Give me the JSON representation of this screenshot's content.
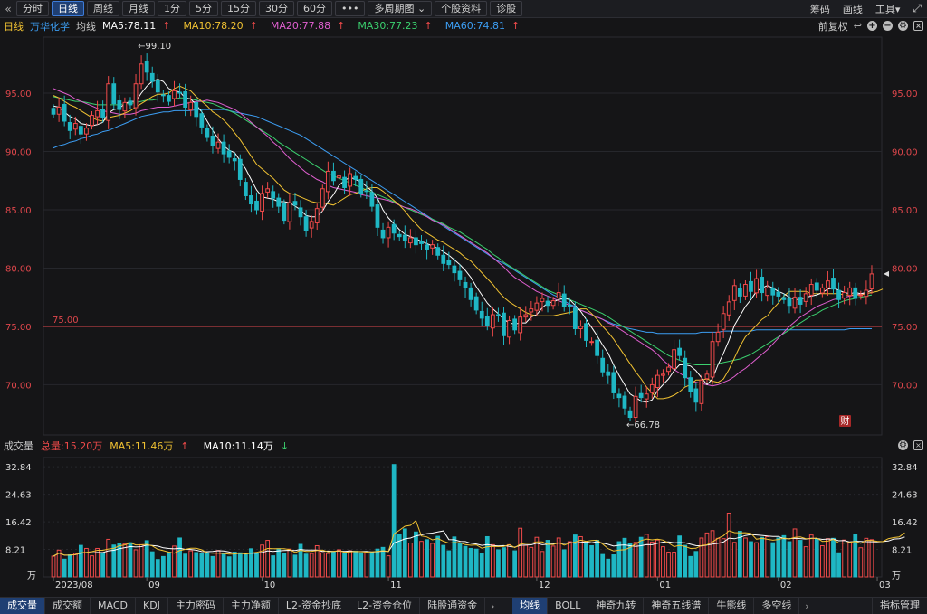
{
  "toolbar": {
    "back_icon": "double-left-chevron",
    "periods": [
      "分时",
      "日线",
      "周线",
      "月线",
      "1分",
      "5分",
      "15分",
      "30分",
      "60分",
      "•••"
    ],
    "active_period": "日线",
    "multi_period": "多周期图",
    "info": "个股资料",
    "diagnose": "诊股",
    "right": {
      "chips": "筹码",
      "draw": "画线",
      "tools": "工具"
    }
  },
  "ma_header": {
    "period": "日线",
    "stock_name": "万华化学",
    "ma_label": "均线",
    "ma5": "MA5:78.11",
    "ma10": "MA10:78.20",
    "ma20": "MA20:77.88",
    "ma30": "MA30:77.23",
    "ma60": "MA60:74.81",
    "adjust": "前复权"
  },
  "colors": {
    "up": "#f04a4a",
    "down": "#1fb7c4",
    "ma5": "#ffffff",
    "ma10": "#f1c232",
    "ma20": "#e05fd0",
    "ma30": "#3bd16f",
    "ma60": "#3c9df2",
    "price_axis": "#e0474c"
  },
  "price_chart": {
    "y_ticks": [
      "95.00",
      "90.00",
      "85.00",
      "80.00",
      "75.00",
      "70.00"
    ],
    "y_tick_values": [
      95,
      90,
      85,
      80,
      75,
      70
    ],
    "ref_line_label": "75.00",
    "ref_line_value": 75,
    "high_label": "←99.10",
    "low_label": "←66.78",
    "badge": "财"
  },
  "volume_header": {
    "title": "成交量",
    "total": "总量:15.20万",
    "ma5": "MA5:11.46万",
    "ma10": "MA10:11.14万"
  },
  "volume_chart": {
    "y_ticks": [
      "32.84",
      "24.63",
      "16.42",
      "8.21",
      "万"
    ],
    "x_labels": [
      "2023/08",
      "09",
      "10",
      "11",
      "12",
      "01",
      "02",
      "03"
    ]
  },
  "chart_data": {
    "type": "candlestick",
    "close": [
      93.2,
      93.8,
      92.6,
      91.8,
      92.4,
      91.5,
      92.0,
      93.1,
      93.5,
      92.9,
      95.8,
      94.1,
      93.6,
      94.2,
      94.0,
      95.8,
      97.5,
      96.8,
      96.0,
      95.1,
      94.8,
      94.3,
      95.2,
      95.0,
      93.8,
      94.2,
      93.0,
      92.1,
      91.2,
      90.5,
      90.8,
      89.8,
      89.5,
      89.2,
      87.6,
      86.2,
      85.5,
      85.0,
      86.4,
      86.8,
      86.0,
      85.3,
      84.1,
      85.6,
      85.4,
      84.4,
      83.2,
      84.0,
      85.1,
      86.8,
      88.3,
      87.5,
      87.9,
      86.9,
      88.1,
      87.6,
      86.4,
      86.6,
      85.3,
      83.5,
      82.6,
      83.5,
      83.0,
      82.7,
      82.4,
      82.6,
      82.0,
      82.1,
      81.6,
      82.0,
      81.1,
      80.4,
      80.3,
      79.6,
      79.0,
      78.3,
      77.3,
      76.4,
      75.7,
      75.1,
      76.0,
      75.9,
      74.2,
      75.5,
      74.7,
      75.8,
      76.0,
      76.5,
      77.0,
      77.4,
      76.8,
      77.2,
      77.9,
      76.7,
      76.8,
      74.8,
      75.0,
      73.8,
      73.7,
      72.5,
      71.1,
      70.8,
      69.3,
      68.9,
      68.0,
      67.2,
      69.0,
      68.9,
      69.2,
      70.0,
      70.8,
      70.9,
      71.5,
      73.0,
      72.5,
      70.6,
      69.4,
      68.5,
      70.4,
      70.9,
      73.7,
      74.5,
      76.1,
      77.1,
      78.5,
      77.6,
      78.6,
      78.0,
      79.1,
      77.9,
      78.3,
      77.7,
      77.6,
      77.3,
      76.8,
      77.5,
      76.9,
      77.8,
      78.6,
      78.1,
      78.3,
      78.9,
      78.2,
      77.3,
      77.9,
      78.3,
      77.4,
      77.7,
      78.1,
      79.5
    ],
    "ma5": [
      93.9,
      93.8,
      93.4,
      93.0,
      92.8,
      92.4,
      92.3,
      92.2,
      92.3,
      92.5,
      93.3,
      93.6,
      93.7,
      94.1,
      94.3,
      94.3,
      95.0,
      95.6,
      96.0,
      96.2,
      96.0,
      95.4,
      95.2,
      95.1,
      94.6,
      94.5,
      94.0,
      93.4,
      92.6,
      91.8,
      91.1,
      90.5,
      90.1,
      89.9,
      89.2,
      88.5,
      87.6,
      86.7,
      86.1,
      86.0,
      85.9,
      85.7,
      85.7,
      85.6,
      85.3,
      85.0,
      84.5,
      84.4,
      84.4,
      84.9,
      85.7,
      86.3,
      87.1,
      87.5,
      87.8,
      87.6,
      87.4,
      87.0,
      86.6,
      86.0,
      85.0,
      84.3,
      83.8,
      83.3,
      82.9,
      82.7,
      82.5,
      82.3,
      82.1,
      81.9,
      81.7,
      81.4,
      81.1,
      80.7,
      80.3,
      79.8,
      79.2,
      78.4,
      77.7,
      77.0,
      76.5,
      76.1,
      75.6,
      75.3,
      75.2,
      75.3,
      75.3,
      75.8,
      76.0,
      76.6,
      77.0,
      77.1,
      77.3,
      77.4,
      77.3,
      76.8,
      76.3,
      75.6,
      74.9,
      74.2,
      73.4,
      72.7,
      71.7,
      70.8,
      70.0,
      69.2,
      68.9,
      68.6,
      68.5,
      68.7,
      69.5,
      70.0,
      70.5,
      71.2,
      71.7,
      71.7,
      71.6,
      71.2,
      70.6,
      70.0,
      70.5,
      71.7,
      72.7,
      73.8,
      75.1,
      75.9,
      76.7,
      77.3,
      78.0,
      78.3,
      78.5,
      78.3,
      78.0,
      77.8,
      77.5,
      77.3,
      77.3,
      77.5,
      77.6,
      77.7,
      77.9,
      78.2,
      78.3,
      78.1,
      77.9,
      77.8,
      77.9,
      77.8,
      77.9,
      78.1
    ],
    "ma10": [
      94.8,
      94.6,
      94.3,
      94.0,
      93.8,
      93.5,
      93.2,
      92.9,
      92.7,
      92.6,
      92.9,
      93.0,
      93.1,
      93.3,
      93.5,
      93.8,
      94.1,
      94.4,
      94.7,
      94.9,
      94.9,
      95.0,
      95.4,
      95.6,
      95.4,
      95.2,
      94.7,
      94.3,
      93.9,
      93.4,
      93.1,
      92.7,
      92.2,
      91.6,
      91.0,
      90.3,
      89.6,
      88.9,
      88.5,
      88.1,
      87.7,
      87.2,
      86.7,
      86.4,
      86.3,
      86.1,
      85.9,
      85.7,
      85.6,
      85.6,
      85.5,
      85.4,
      85.7,
      86.0,
      86.3,
      86.4,
      86.6,
      86.8,
      86.9,
      86.9,
      86.6,
      86.2,
      85.8,
      85.4,
      84.9,
      84.3,
      83.8,
      83.3,
      83.0,
      82.7,
      82.4,
      82.2,
      81.9,
      81.6,
      81.3,
      80.9,
      80.6,
      80.1,
      79.6,
      79.1,
      78.6,
      78.0,
      77.5,
      77.1,
      76.8,
      76.5,
      76.2,
      76.0,
      75.9,
      75.9,
      75.9,
      75.9,
      76.0,
      76.1,
      76.2,
      76.3,
      76.5,
      76.5,
      76.1,
      75.6,
      75.0,
      74.5,
      73.9,
      73.2,
      72.5,
      71.8,
      71.1,
      70.5,
      69.8,
      69.3,
      68.8,
      68.8,
      68.9,
      69.1,
      69.4,
      69.8,
      70.0,
      70.4,
      70.4,
      70.5,
      70.3,
      70.2,
      70.5,
      71.3,
      72.3,
      73.3,
      74.1,
      74.6,
      75.1,
      75.6,
      75.9,
      76.5,
      77.0,
      77.6,
      78.0,
      78.0,
      78.0,
      78.0,
      77.8,
      77.8,
      77.8,
      77.8,
      77.8,
      77.8,
      77.7,
      77.7,
      77.7,
      77.7,
      77.8,
      77.9,
      78.0,
      78.2
    ],
    "ma20": [
      95.4,
      95.2,
      95.0,
      94.8,
      94.5,
      94.3,
      94.1,
      93.9,
      93.7,
      93.5,
      93.4,
      93.3,
      93.2,
      93.2,
      93.2,
      93.3,
      93.5,
      93.6,
      93.7,
      93.8,
      93.8,
      93.8,
      93.9,
      94.0,
      94.1,
      94.2,
      94.3,
      94.3,
      94.4,
      94.3,
      94.2,
      94.0,
      93.8,
      93.6,
      93.3,
      92.9,
      92.5,
      92.1,
      91.7,
      91.3,
      90.8,
      90.4,
      89.9,
      89.4,
      89.0,
      88.6,
      88.2,
      87.9,
      87.6,
      87.4,
      87.1,
      86.9,
      86.8,
      86.7,
      86.6,
      86.5,
      86.3,
      86.2,
      86.1,
      86.0,
      85.9,
      85.8,
      85.6,
      85.4,
      85.2,
      85.1,
      84.9,
      84.7,
      84.4,
      84.1,
      83.9,
      83.7,
      83.4,
      83.1,
      82.8,
      82.5,
      82.2,
      81.9,
      81.6,
      81.3,
      80.9,
      80.5,
      80.1,
      79.6,
      79.2,
      78.9,
      78.6,
      78.3,
      78.0,
      77.8,
      77.6,
      77.4,
      77.2,
      77.0,
      76.8,
      76.6,
      76.4,
      76.2,
      76.0,
      75.8,
      75.6,
      75.3,
      75.1,
      74.8,
      74.5,
      74.2,
      73.9,
      73.6,
      73.3,
      73.0,
      72.6,
      72.1,
      71.7,
      71.3,
      71.0,
      70.7,
      70.4,
      70.2,
      70.1,
      70.0,
      69.9,
      70.0,
      70.2,
      70.4,
      70.7,
      71.1,
      71.4,
      71.8,
      72.2,
      72.6,
      73.0,
      73.5,
      74.0,
      74.5,
      75.0,
      75.4,
      75.8,
      76.1,
      76.4,
      76.7,
      76.9,
      77.1,
      77.3,
      77.4,
      77.5,
      77.6,
      77.7,
      77.8,
      77.8,
      77.9
    ],
    "ma30": [
      94.7,
      94.6,
      94.5,
      94.4,
      94.3,
      94.3,
      94.2,
      94.1,
      94.0,
      94.0,
      94.0,
      94.0,
      94.0,
      94.1,
      94.1,
      94.2,
      94.3,
      94.4,
      94.4,
      94.5,
      94.5,
      94.5,
      94.5,
      94.6,
      94.6,
      94.5,
      94.4,
      94.3,
      94.2,
      94.1,
      93.9,
      93.7,
      93.5,
      93.3,
      93.0,
      92.7,
      92.4,
      92.1,
      91.8,
      91.5,
      91.2,
      90.8,
      90.5,
      90.2,
      89.9,
      89.6,
      89.3,
      89.0,
      88.7,
      88.4,
      88.1,
      87.9,
      87.7,
      87.5,
      87.3,
      87.1,
      86.9,
      86.7,
      86.5,
      86.3,
      86.1,
      85.9,
      85.7,
      85.4,
      85.2,
      85.0,
      84.8,
      84.6,
      84.4,
      84.2,
      84.0,
      83.8,
      83.5,
      83.3,
      83.1,
      82.8,
      82.5,
      82.2,
      81.9,
      81.6,
      81.2,
      80.9,
      80.5,
      80.2,
      79.9,
      79.6,
      79.3,
      79.0,
      78.7,
      78.4,
      78.1,
      77.9,
      77.7,
      77.5,
      77.3,
      77.1,
      76.9,
      76.7,
      76.5,
      76.3,
      76.1,
      75.8,
      75.5,
      75.2,
      74.9,
      74.6,
      74.3,
      74.0,
      73.7,
      73.4,
      73.1,
      72.8,
      72.5,
      72.3,
      72.1,
      71.9,
      71.8,
      71.7,
      71.7,
      71.7,
      71.7,
      71.8,
      71.9,
      72.0,
      72.1,
      72.2,
      72.4,
      72.6,
      72.9,
      73.2,
      73.5,
      73.8,
      74.1,
      74.4,
      74.7,
      75.0,
      75.3,
      75.6,
      75.9,
      76.1,
      76.4,
      76.6,
      76.8,
      77.0,
      77.2,
      77.3,
      77.4,
      77.5,
      77.6,
      77.7
    ],
    "ma60": [
      90.3,
      90.5,
      90.6,
      90.8,
      90.9,
      91.1,
      91.2,
      91.4,
      91.5,
      91.7,
      91.8,
      92.0,
      92.2,
      92.4,
      92.6,
      92.8,
      93.0,
      93.1,
      93.2,
      93.3,
      93.4,
      93.4,
      93.5,
      93.5,
      93.5,
      93.5,
      93.6,
      93.6,
      93.6,
      93.6,
      93.6,
      93.6,
      93.5,
      93.4,
      93.3,
      93.2,
      93.1,
      93.0,
      92.8,
      92.6,
      92.4,
      92.2,
      92.0,
      91.8,
      91.6,
      91.4,
      91.1,
      90.8,
      90.5,
      90.2,
      89.9,
      89.6,
      89.3,
      89.0,
      88.7,
      88.4,
      88.1,
      87.8,
      87.5,
      87.2,
      86.9,
      86.6,
      86.3,
      86.0,
      85.7,
      85.4,
      85.1,
      84.8,
      84.5,
      84.2,
      83.9,
      83.6,
      83.3,
      83.0,
      82.7,
      82.4,
      82.1,
      81.8,
      81.5,
      81.2,
      80.9,
      80.6,
      80.4,
      80.1,
      79.8,
      79.5,
      79.2,
      78.9,
      78.6,
      78.3,
      78.0,
      77.7,
      77.5,
      77.2,
      76.9,
      76.7,
      76.4,
      76.2,
      76.0,
      75.8,
      75.6,
      75.4,
      75.2,
      75.1,
      74.9,
      74.8,
      74.7,
      74.6,
      74.5,
      74.5,
      74.4,
      74.4,
      74.4,
      74.4,
      74.4,
      74.4,
      74.4,
      74.4,
      74.5,
      74.5,
      74.5,
      74.5,
      74.6,
      74.6,
      74.6,
      74.6,
      74.6,
      74.6,
      74.7,
      74.7,
      74.7,
      74.7,
      74.7,
      74.7,
      74.7,
      74.7,
      74.7,
      74.7,
      74.7,
      74.7,
      74.7,
      74.7,
      74.7,
      74.7,
      74.7,
      74.8,
      74.8,
      74.8,
      74.8,
      74.8
    ],
    "volume": [
      6.2,
      8.0,
      5.3,
      6.6,
      7.0,
      9.4,
      8.5,
      6.3,
      8.5,
      7.1,
      11.2,
      9.5,
      10.1,
      9.8,
      10.2,
      8.1,
      9.6,
      10.8,
      7.5,
      5.2,
      6.1,
      7.4,
      9.2,
      11.6,
      6.8,
      7.8,
      7.3,
      6.9,
      7.2,
      6.1,
      7.9,
      6.8,
      6.0,
      7.4,
      7.2,
      6.6,
      8.4,
      7.1,
      9.5,
      10.9,
      6.3,
      8.4,
      6.9,
      8.3,
      6.5,
      9.7,
      6.8,
      7.0,
      9.3,
      7.2,
      7.0,
      7.6,
      8.1,
      6.9,
      7.8,
      7.7,
      7.2,
      7.5,
      7.3,
      8.3,
      8.8,
      6.3,
      33.5,
      12.6,
      14.3,
      10.1,
      13.4,
      10.6,
      11.1,
      10.0,
      12.1,
      9.4,
      7.8,
      11.9,
      9.9,
      9.1,
      8.5,
      8.3,
      7.1,
      12.0,
      9.6,
      8.1,
      8.7,
      9.6,
      7.8,
      14.5,
      9.4,
      8.8,
      11.8,
      7.6,
      10.9,
      9.2,
      11.6,
      8.1,
      10.5,
      12.5,
      12.0,
      10.0,
      9.3,
      10.9,
      6.7,
      5.3,
      6.6,
      10.5,
      11.5,
      10.1,
      10.3,
      11.8,
      12.7,
      10.4,
      11.0,
      9.0,
      7.4,
      7.4,
      12.2,
      9.4,
      6.1,
      7.6,
      11.6,
      13.1,
      13.8,
      11.5,
      11.4,
      19.0,
      10.3,
      13.6,
      11.6,
      10.5,
      10.2,
      11.8,
      12.0,
      10.2,
      11.6,
      12.3,
      10.5,
      14.3,
      10.9,
      9.0,
      12.5,
      11.2,
      9.3,
      11.4,
      11.5,
      7.2,
      11.0,
      10.4,
      12.8,
      8.7,
      11.5,
      11.1,
      9.0,
      12.2,
      13.2,
      13.1,
      12.1,
      15.2
    ]
  }
}
